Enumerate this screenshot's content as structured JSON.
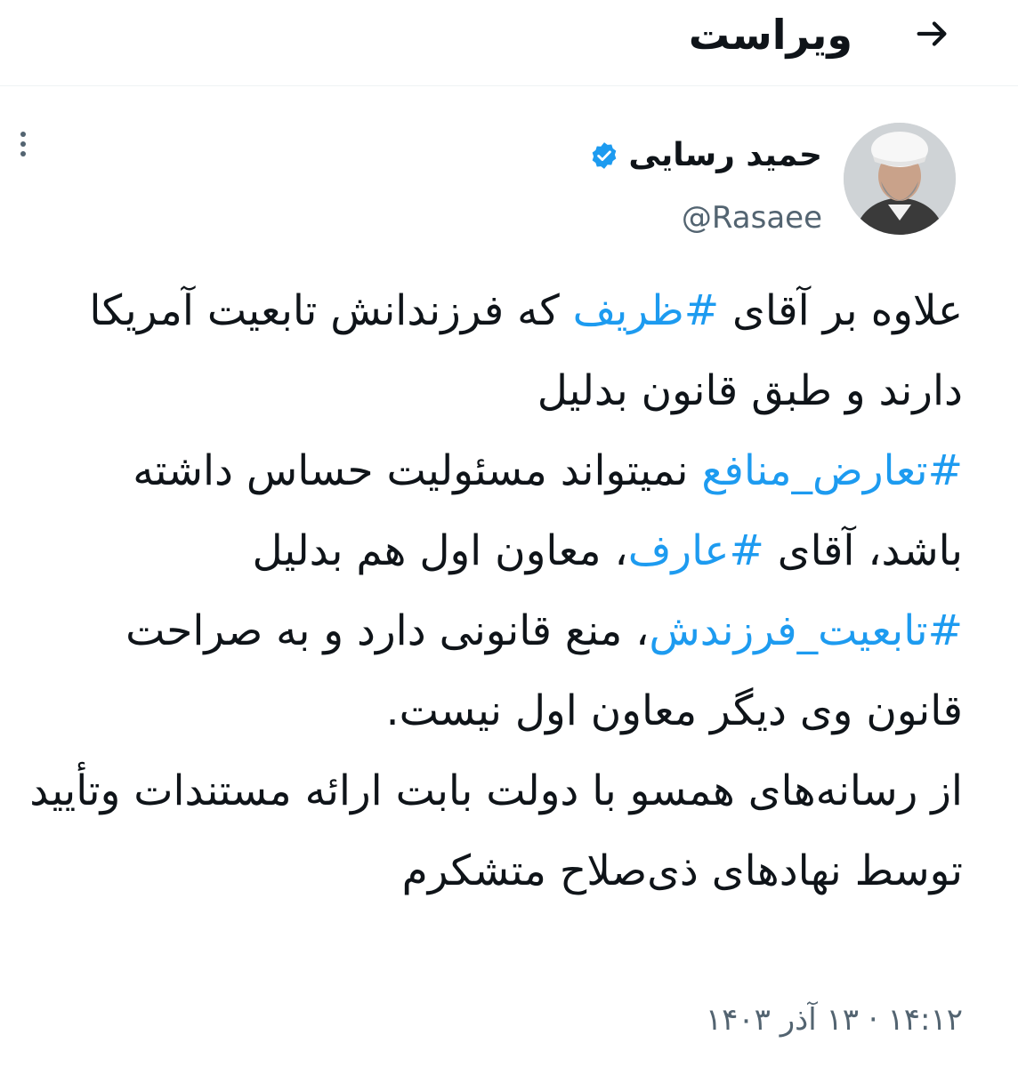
{
  "header": {
    "title": "ویراست",
    "back_icon": "arrow-right-icon"
  },
  "author": {
    "display_name": "حمید رسایی",
    "handle": "@Rasaee",
    "verified_icon": "verified-badge-icon",
    "verified_color": "#1d9bf0"
  },
  "tweet": {
    "segments": [
      {
        "text": "علاوه بر آقای ",
        "hashtag": false
      },
      {
        "text": "#ظریف",
        "hashtag": true
      },
      {
        "text": " که فرزندانش تابعیت آمریکا دارند و طبق قانون بدلیل ",
        "hashtag": false
      },
      {
        "text": "#تعارض_منافع",
        "hashtag": true
      },
      {
        "text": " نمیتواند مسئولیت حساس داشته باشد، آقای ",
        "hashtag": false
      },
      {
        "text": "#عارف",
        "hashtag": true
      },
      {
        "text": "، معاون اول هم بدلیل ",
        "hashtag": false
      },
      {
        "text": "#تابعیت_فرزندش",
        "hashtag": true
      },
      {
        "text": "، منع قانونی دارد و به صراحت قانون وی دیگر معاون اول نیست.",
        "hashtag": false
      },
      {
        "text": "\nاز رسانه‌های همسو با دولت بابت ارائه مستندات وتأیید توسط نهادهای ذی‌صلاح متشکرم",
        "hashtag": false
      }
    ],
    "timestamp": "۱۴:۱۲ · ۱۳ آذر ۱۴۰۳"
  },
  "colors": {
    "text": "#0f1419",
    "secondary": "#536471",
    "link": "#1d9bf0"
  }
}
